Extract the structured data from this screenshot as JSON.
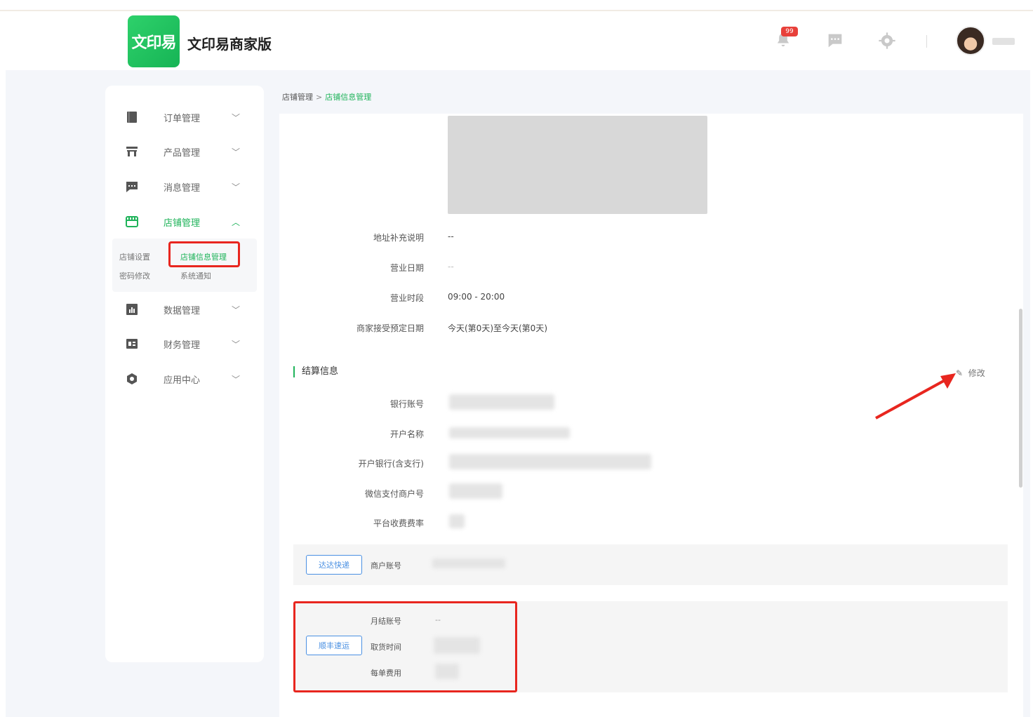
{
  "header": {
    "logo_text": "文印易",
    "brand_name": "文印易商家版",
    "notification_count": "99",
    "icons": [
      "bell-icon",
      "chat-icon",
      "gear-icon"
    ],
    "accent_color": "#1fb35a"
  },
  "sidebar": {
    "items": [
      {
        "label": "订单管理",
        "icon": "book-icon",
        "expanded": false
      },
      {
        "label": "产品管理",
        "icon": "store-icon",
        "expanded": false
      },
      {
        "label": "消息管理",
        "icon": "message-icon",
        "expanded": false
      },
      {
        "label": "店铺管理",
        "icon": "shop-icon",
        "expanded": true
      },
      {
        "label": "数据管理",
        "icon": "chart-icon",
        "expanded": false
      },
      {
        "label": "财务管理",
        "icon": "finance-icon",
        "expanded": false
      },
      {
        "label": "应用中心",
        "icon": "apps-icon",
        "expanded": false
      }
    ],
    "submenu": {
      "shop_settings": "店铺设置",
      "shop_info": "店铺信息管理",
      "password_change": "密码修改",
      "system_notice": "系统通知"
    }
  },
  "breadcrumb": {
    "parent": "店铺管理",
    "separator": ">",
    "current": "店铺信息管理"
  },
  "shop_info": {
    "rows": [
      {
        "label": "地址补充说明",
        "value": "--"
      },
      {
        "label": "营业日期",
        "value": "--"
      },
      {
        "label": "营业时段",
        "value": "09:00 - 20:00"
      },
      {
        "label": "商家接受预定日期",
        "value": "今天(第0天)至今天(第0天)"
      }
    ]
  },
  "settlement": {
    "title": "结算信息",
    "edit_label": "修改",
    "rows": [
      {
        "label": "银行账号"
      },
      {
        "label": "开户名称"
      },
      {
        "label": "开户银行(含支行)"
      },
      {
        "label": "微信支付商户号"
      },
      {
        "label": "平台收费费率"
      }
    ]
  },
  "shipping": {
    "express": {
      "button": "达达快递",
      "account_label": "商户账号"
    },
    "sf": {
      "button": "顺丰速运",
      "account_label": "月结账号",
      "account_value": "--",
      "time_label": "取货时间",
      "fee_label": "每单费用"
    }
  }
}
